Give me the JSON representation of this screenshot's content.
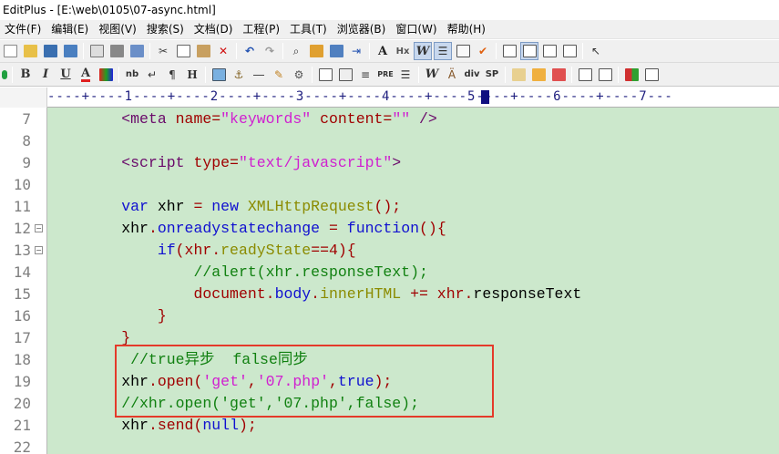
{
  "window": {
    "title": "EditPlus - [E:\\web\\0105\\07-async.html]"
  },
  "menu": [
    "文件(F)",
    "编辑(E)",
    "视图(V)",
    "搜索(S)",
    "文档(D)",
    "工程(P)",
    "工具(T)",
    "浏览器(B)",
    "窗口(W)",
    "帮助(H)"
  ],
  "toolbar2_text": {
    "bold": "B",
    "italic": "I",
    "underline": "U",
    "font_color": "A",
    "nbsp": "nb",
    "break": "↵",
    "para": "¶",
    "heading": "H",
    "pre": "PRE",
    "word": "W",
    "div": "div",
    "span": "SP",
    "hx": "Hx"
  },
  "ruler": {
    "text": "----+----1----+----2----+----3----+----4----+----5----+----6----+----7---"
  },
  "line_numbers": [
    "7",
    "8",
    "9",
    "10",
    "11",
    "12",
    "13",
    "14",
    "15",
    "16",
    "17",
    "18",
    "19",
    "20",
    "21",
    "22"
  ],
  "code": {
    "l7": {
      "indent": "        ",
      "a": "<meta ",
      "b": "name=",
      "c": "\"keywords\"",
      "d": " content=",
      "e": "\"\"",
      "f": " />"
    },
    "l9": {
      "indent": "        ",
      "a": "<script ",
      "b": "type=",
      "c": "\"text/javascript\"",
      "d": ">"
    },
    "l11": {
      "indent": "        ",
      "a": "var",
      "b": " xhr ",
      "c": "=",
      "d": " new ",
      "e": "XMLHttpRequest",
      "f": "();"
    },
    "l12": {
      "indent": "        ",
      "a": "xhr",
      "b": ".",
      "c": "onreadystatechange",
      "d": " = ",
      "e": "function",
      "f": "(){"
    },
    "l13": {
      "indent": "            ",
      "a": "if",
      "b": "(xhr.",
      "c": "readyState",
      "d": "==4){"
    },
    "l14": {
      "indent": "                ",
      "a": "//alert(xhr.responseText);"
    },
    "l15": {
      "indent": "                ",
      "a": "document",
      "b": ".",
      "c": "body",
      "d": ".",
      "e": "innerHTML",
      "f": " += xhr.",
      "g": "responseText"
    },
    "l16": {
      "indent": "            ",
      "a": "}"
    },
    "l17": {
      "indent": "        ",
      "a": "}"
    },
    "l18": {
      "indent": "         ",
      "a": "//true异步  false同步"
    },
    "l19": {
      "indent": "        ",
      "a": "xhr",
      "b": ".",
      "c": "open",
      "d": "(",
      "e": "'get'",
      "f": ",",
      "g": "'07.php'",
      "h": ",",
      "i": "true",
      "j": ");"
    },
    "l20": {
      "indent": "        ",
      "a": "//xhr.open('get','07.php',false);"
    },
    "l21": {
      "indent": "        ",
      "a": "xhr",
      "b": ".",
      "c": "send",
      "d": "(",
      "e": "null",
      "f": ");"
    }
  }
}
